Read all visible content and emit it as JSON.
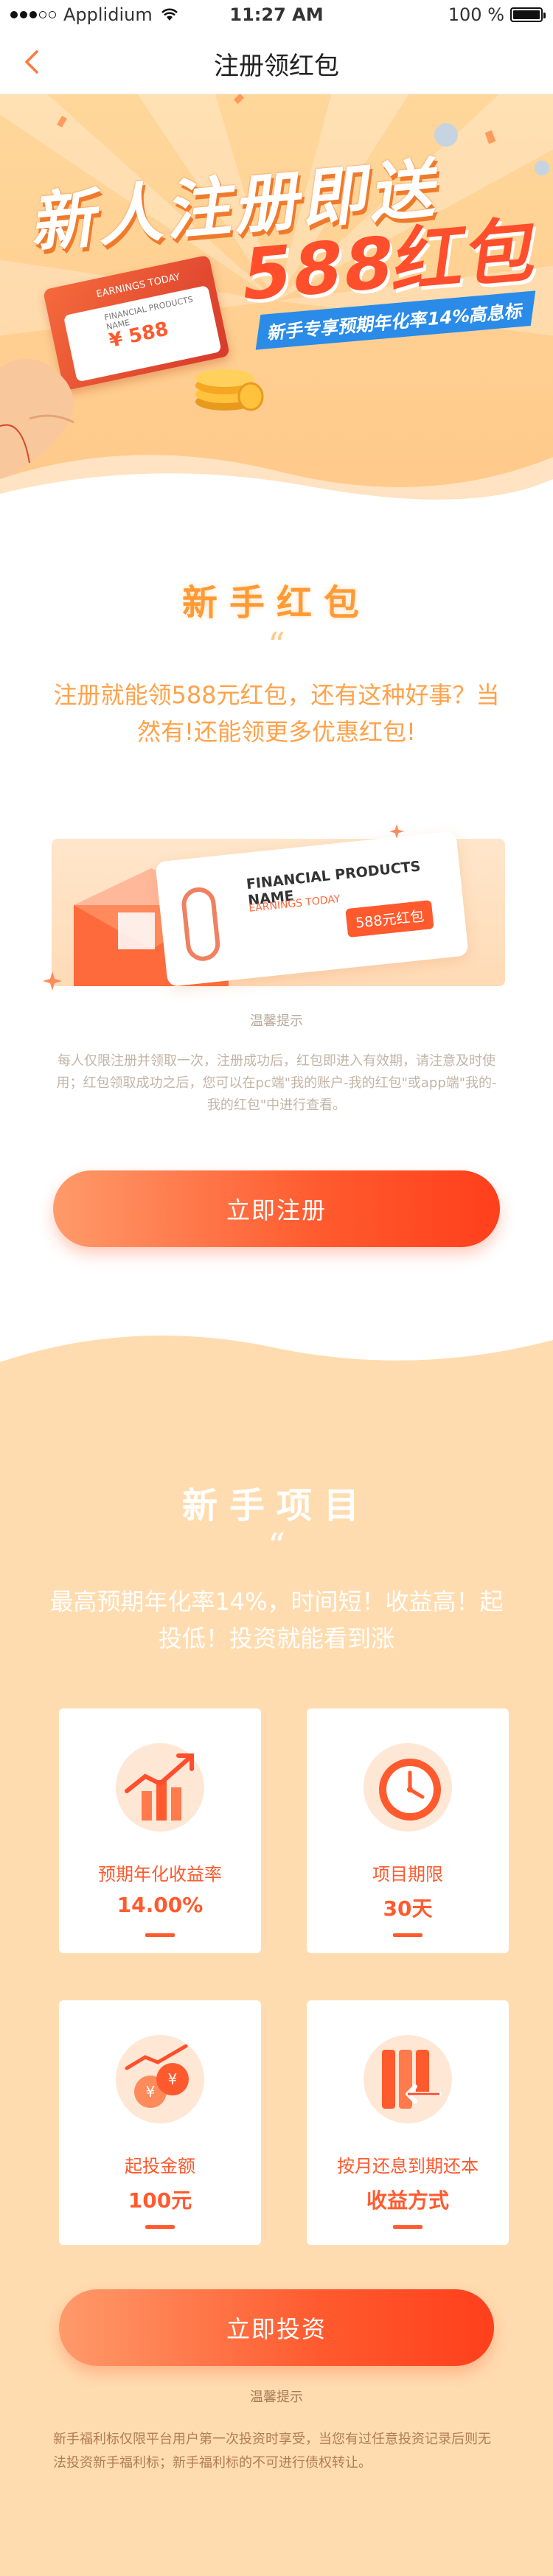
{
  "status_bar": {
    "carrier": "Applidium",
    "time": "11:27 AM",
    "battery": "100 %"
  },
  "nav": {
    "title": "注册领红包"
  },
  "hero": {
    "headline": "新人注册即送",
    "amount": "588红包",
    "subtitle": "新手专享预期年化率14%高息标",
    "card_label": "EARNINGS TODAY",
    "card_product": "FINANCIAL PRODUCTS NAME",
    "card_amount": "¥ 588"
  },
  "red_packet": {
    "title": "新手红包",
    "quote": "“",
    "description": "注册就能领588元红包，还有这种好事？当然有!还能领更多优惠红包!",
    "coupon_product": "FINANCIAL PRODUCTS NAME",
    "coupon_earnings": "EARNINGS TODAY",
    "coupon_amount": "588元红包",
    "tips_label": "温馨提示",
    "tips_body": "每人仅限注册并领取一次，注册成功后，红包即进入有效期，请注意及时使用；红包领取成功之后，您可以在pc端\"我的账户-我的红包\"或app端\"我的-我的红包\"中进行查看。",
    "register_button": "立即注册"
  },
  "projects": {
    "title": "新手项目",
    "quote": "“",
    "description": "最高预期年化率14%，时间短！收益高！起投低！投资就能看到涨",
    "features": [
      {
        "label": "预期年化收益率",
        "value": "14.00%",
        "icon": "growth-chart-icon"
      },
      {
        "label": "项目期限",
        "value": "30天",
        "icon": "clock-icon"
      },
      {
        "label": "起投金额",
        "value": "100元",
        "icon": "coins-icon"
      },
      {
        "label": "按月还息到期还本",
        "value": "收益方式",
        "icon": "repayment-icon"
      }
    ],
    "invest_button": "立即投资",
    "tips_label": "温馨提示",
    "tips_body": "新手福利标仅限平台用户第一次投资时享受，当您有过任意投资记录后则无法投资新手福利标；新手福利标的不可进行债权转让。"
  },
  "colors": {
    "accent": "#ff5a2e",
    "orange_text": "#ffa24a",
    "banner_bg": "#ffd79b",
    "section_bg": "#ffdcb0"
  }
}
